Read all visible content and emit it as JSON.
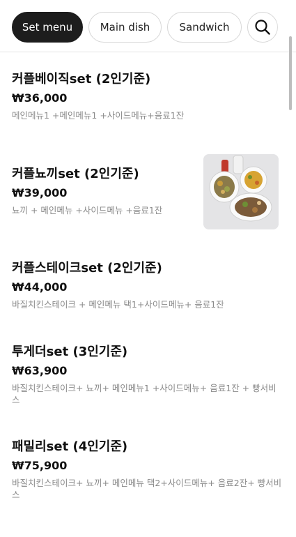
{
  "tabs": {
    "items": [
      "Set menu",
      "Main dish",
      "Sandwich"
    ],
    "search_icon": "search-icon"
  },
  "menu": [
    {
      "name": "커플베이직set (2인기준)",
      "price": "₩36,000",
      "desc": "메인메뉴1 +메인메뉴1 +사이드메뉴+음료1잔"
    },
    {
      "name": "커플뇨끼set (2인기준)",
      "price": "₩39,000",
      "desc": "뇨끼 + 메인메뉴 +사이드메뉴 +음료1잔"
    },
    {
      "name": "커플스테이크set (2인기준)",
      "price": "₩44,000",
      "desc": "바질치킨스테이크 + 메인메뉴 택1+사이드메뉴+ 음료1잔"
    },
    {
      "name": "투게더set (3인기준)",
      "price": "₩63,900",
      "desc": "바질치킨스테이크+ 뇨끼+ 메인메뉴1 +사이드메뉴+ 음료1잔 + 빵서비스"
    },
    {
      "name": "패밀리set (4인기준)",
      "price": "₩75,900",
      "desc": "바질치킨스테이크+ 뇨끼+ 메인메뉴 택2+사이드메뉴+ 음료2잔+ 빵서비스"
    }
  ],
  "colors": {
    "active_tab": "#1d1d1d",
    "desc_gray": "#8a8a8a"
  }
}
